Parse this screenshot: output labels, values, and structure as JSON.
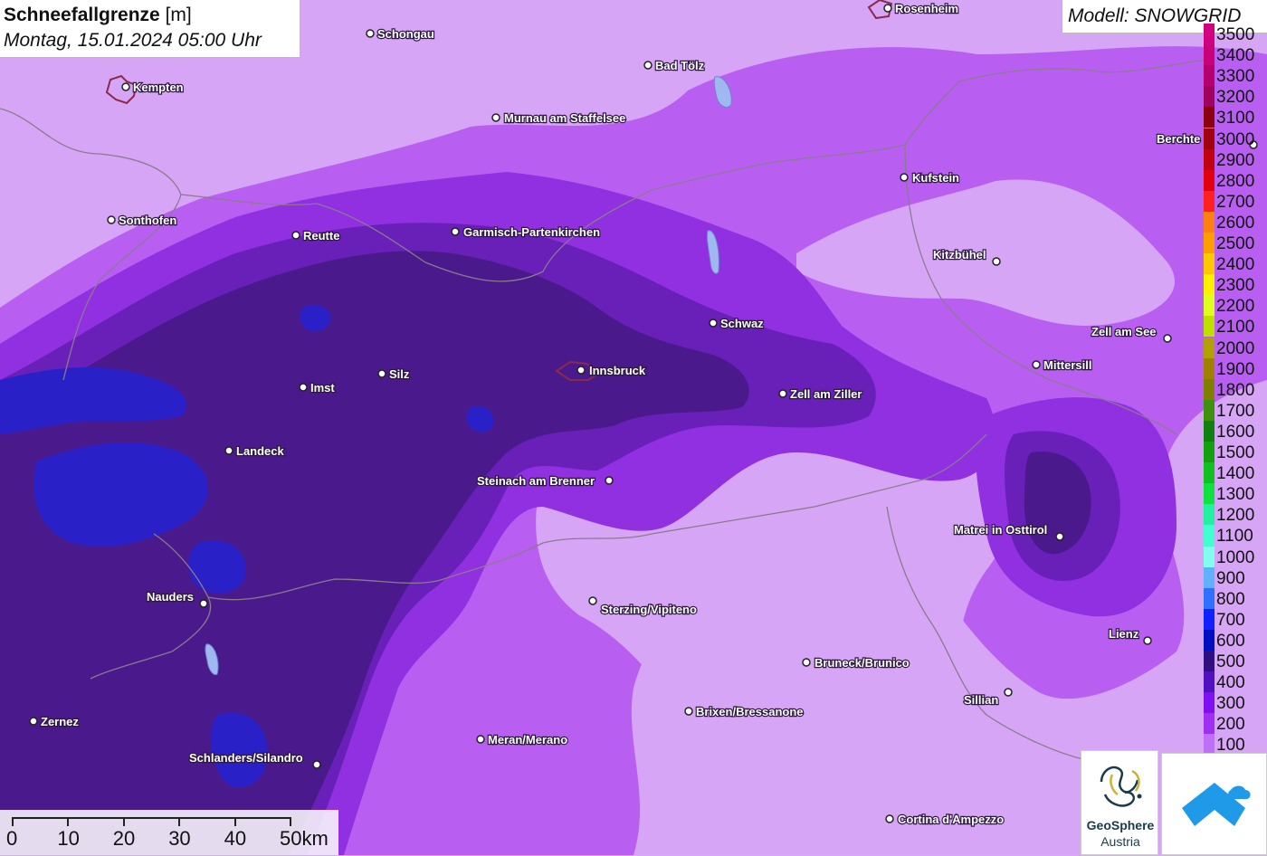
{
  "title": {
    "main": "Schneefallgrenze",
    "unit": "[m]",
    "datetime": "Montag, 15.01.2024 05:00 Uhr"
  },
  "model_label": "Modell: SNOWGRID",
  "legend": {
    "entries": [
      {
        "label": "3500",
        "color": "#d00080"
      },
      {
        "label": "3400",
        "color": "#c8007a"
      },
      {
        "label": "3300",
        "color": "#b50070"
      },
      {
        "label": "3200",
        "color": "#a00060"
      },
      {
        "label": "3100",
        "color": "#8a0010"
      },
      {
        "label": "3000",
        "color": "#a00010"
      },
      {
        "label": "2900",
        "color": "#c00010"
      },
      {
        "label": "2800",
        "color": "#e00010"
      },
      {
        "label": "2700",
        "color": "#ff2020"
      },
      {
        "label": "2600",
        "color": "#ff7f10"
      },
      {
        "label": "2500",
        "color": "#ffa000"
      },
      {
        "label": "2400",
        "color": "#ffc800"
      },
      {
        "label": "2300",
        "color": "#fff000"
      },
      {
        "label": "2200",
        "color": "#e0ff20"
      },
      {
        "label": "2100",
        "color": "#c0e000"
      },
      {
        "label": "2000",
        "color": "#b0a000"
      },
      {
        "label": "1900",
        "color": "#a08000"
      },
      {
        "label": "1800",
        "color": "#808000"
      },
      {
        "label": "1700",
        "color": "#409010"
      },
      {
        "label": "1600",
        "color": "#108010"
      },
      {
        "label": "1500",
        "color": "#10a010"
      },
      {
        "label": "1400",
        "color": "#10c020"
      },
      {
        "label": "1300",
        "color": "#10e040"
      },
      {
        "label": "1200",
        "color": "#20f0a0"
      },
      {
        "label": "1100",
        "color": "#40ffd0"
      },
      {
        "label": "1000",
        "color": "#80fff0"
      },
      {
        "label": "900",
        "color": "#60b0ff"
      },
      {
        "label": "800",
        "color": "#3070ff"
      },
      {
        "label": "700",
        "color": "#1020ff"
      },
      {
        "label": "600",
        "color": "#0010c0"
      },
      {
        "label": "500",
        "color": "#301080"
      },
      {
        "label": "400",
        "color": "#5010c0"
      },
      {
        "label": "300",
        "color": "#8010f0"
      },
      {
        "label": "200",
        "color": "#a030f0"
      },
      {
        "label": "100",
        "color": "#c070f8"
      }
    ]
  },
  "scalebar": {
    "labels": [
      "0",
      "10",
      "20",
      "30",
      "40",
      "50km"
    ]
  },
  "logos": {
    "geosphere_name": "GeoSphere",
    "geosphere_country": "Austria"
  },
  "places": [
    {
      "name": "Schongau"
    },
    {
      "name": "Rosenheim"
    },
    {
      "name": "Kempten"
    },
    {
      "name": "Bad Tölz"
    },
    {
      "name": "Murnau am Staffelsee"
    },
    {
      "name": "Berchtesgaden",
      "shown_text": "Berchte"
    },
    {
      "name": "Kufstein"
    },
    {
      "name": "Sonthofen"
    },
    {
      "name": "Reutte"
    },
    {
      "name": "Garmisch-Partenkirchen"
    },
    {
      "name": "Kitzbühel"
    },
    {
      "name": "Schwaz"
    },
    {
      "name": "Zell am See"
    },
    {
      "name": "Mittersill"
    },
    {
      "name": "Innsbruck"
    },
    {
      "name": "Silz"
    },
    {
      "name": "Imst"
    },
    {
      "name": "Zell am Ziller"
    },
    {
      "name": "Landeck"
    },
    {
      "name": "Steinach am Brenner"
    },
    {
      "name": "Matrei in Osttirol"
    },
    {
      "name": "Nauders"
    },
    {
      "name": "Sterzing/Vipiteno"
    },
    {
      "name": "Lienz"
    },
    {
      "name": "Bruneck/Brunico"
    },
    {
      "name": "Sillian"
    },
    {
      "name": "Brixen/Bressanone"
    },
    {
      "name": "Zernez"
    },
    {
      "name": "Meran/Merano"
    },
    {
      "name": "Schlanders/Silandro"
    },
    {
      "name": "Cortina d'Ampezzo"
    }
  ]
}
